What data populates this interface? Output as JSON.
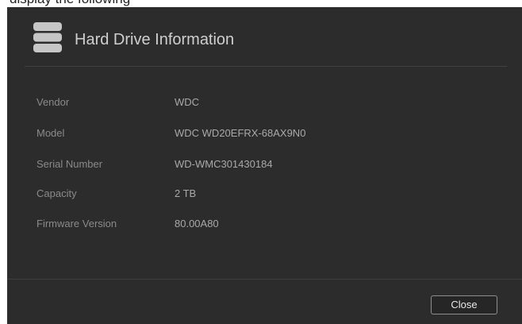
{
  "background_caption": "display the following",
  "dialog": {
    "title": "Hard Drive Information",
    "icon": "hard-drive-stack-icon",
    "rows": [
      {
        "label": "Vendor",
        "value": "WDC"
      },
      {
        "label": "Model",
        "value": "WDC WD20EFRX-68AX9N0"
      },
      {
        "label": "Serial Number",
        "value": "WD-WMC301430184"
      },
      {
        "label": "Capacity",
        "value": "2 TB"
      },
      {
        "label": "Firmware Version",
        "value": "80.00A80"
      }
    ],
    "close_label": "Close"
  },
  "colors": {
    "dialog_background": "#2c2c2c",
    "title_text": "#cfcfcf",
    "label_text": "#8a8a8a",
    "value_text": "#a9a9a9",
    "icon": "#c6c6c6"
  }
}
